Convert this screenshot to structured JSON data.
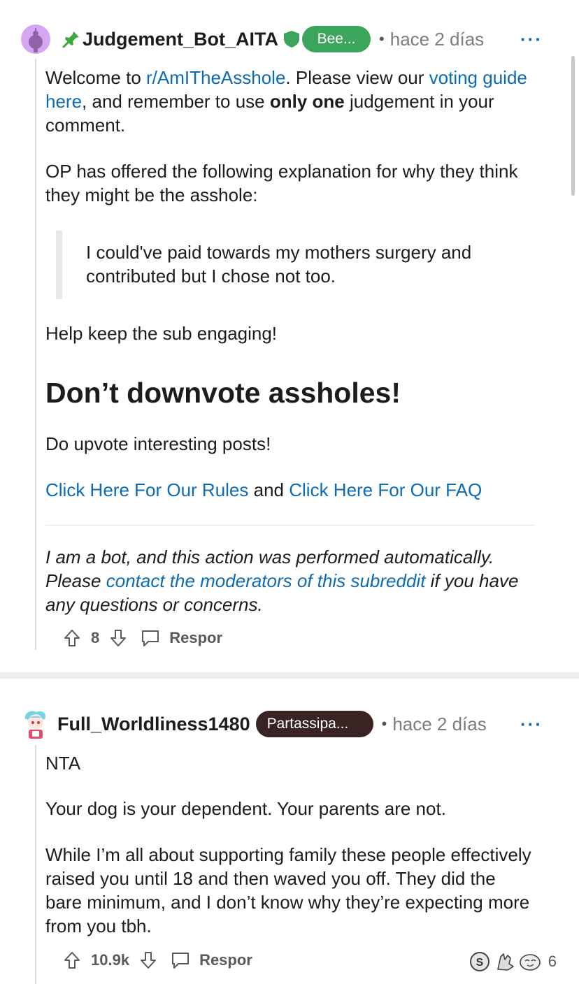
{
  "comment1": {
    "username": "Judgement_Bot_AITA",
    "flair": "Bee...",
    "separator_dot": "•",
    "time": "hace 2 días",
    "more": "···",
    "welcome_prefix": "Welcome to ",
    "subreddit_link": "r/AmITheAsshole",
    "welcome_mid": ". Please view our ",
    "voting_guide_link": "voting guide here",
    "welcome_mid2": ", and remember to use ",
    "welcome_bold": "only one",
    "welcome_suffix": " judgement in your comment.",
    "explain_text": "OP has offered the following explanation for why they think they might be the asshole:",
    "quote_text": "I could've paid towards my mothers surgery and contributed but I chose not too.",
    "engage_text": "Help keep the sub engaging!",
    "heading": "Don’t downvote assholes!",
    "upvote_text": "Do upvote interesting posts!",
    "rules_link": "Click Here For Our Rules",
    "and_text": " and ",
    "faq_link": "Click Here For Our FAQ",
    "bot_prefix": "I am a bot, and this action was performed automatically. Please ",
    "contact_link": "contact the moderators of this subreddit",
    "bot_suffix": " if you have any questions or concerns.",
    "vote_count": "8",
    "reply_label": "Respor"
  },
  "comment2": {
    "username": "Full_Worldliness1480",
    "flair": "Partassipa...",
    "separator_dot": "•",
    "time": "hace 2 días",
    "more": "···",
    "verdict": "NTA",
    "para1": "Your dog is your dependent. Your parents are not.",
    "para2": "While I’m all about supporting family these people effectively raised you until 18 and then waved you off. They did the bare minimum, and I don’t know why they’re expecting more from you tbh.",
    "vote_count": "10.9k",
    "reply_label": "Respor",
    "award_count": "6"
  },
  "colors": {
    "link": "#0b6bb5",
    "bot_flair": "#3ba55c",
    "user_flair": "#3a2323",
    "pin": "#3aa83a"
  }
}
